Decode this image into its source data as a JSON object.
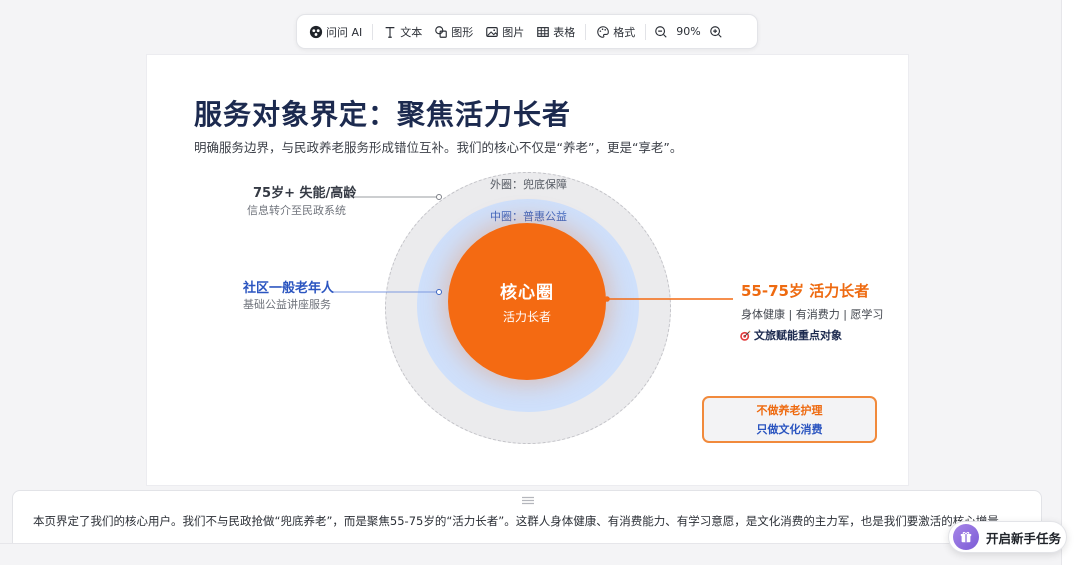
{
  "toolbar": {
    "ask_ai": "问问 AI",
    "text": "文本",
    "shape": "图形",
    "image": "图片",
    "table": "表格",
    "format": "格式",
    "zoom": "90%"
  },
  "slide": {
    "title": "服务对象界定：聚焦活力长者",
    "subtitle": "明确服务边界，与民政养老服务形成错位互补。我们的核心不仅是“养老”，更是“享老”。",
    "ring_outer_label": "外圈：兜底保障",
    "ring_mid_label": "中圈：普惠公益",
    "core_title": "核心圈",
    "core_sub": "活力长者",
    "label_outer_title": "75岁+ 失能/高龄",
    "label_outer_sub": "信息转介至民政系统",
    "label_mid_title": "社区一般老年人",
    "label_mid_sub": "基础公益讲座服务",
    "label_core_title": "55-75岁 活力长者",
    "label_core_sub": "身体健康 | 有消费力 | 愿学习",
    "label_core_tag": "文旅赋能重点对象",
    "note_line1": "不做养老护理",
    "note_line2": "只做文化消费"
  },
  "notes": {
    "text": "本页界定了我们的核心用户。我们不与民政抢做“兜底养老”，而是聚焦55-75岁的“活力长者”。这群人身体健康、有消费能力、有学习意愿，是文化消费的主力军，也是我们要激活的核心增量。"
  },
  "new_task": {
    "label": "开启新手任务"
  },
  "colors": {
    "accent_orange": "#f46a12",
    "accent_blue": "#2b55c0",
    "title_navy": "#1c2a4f"
  }
}
